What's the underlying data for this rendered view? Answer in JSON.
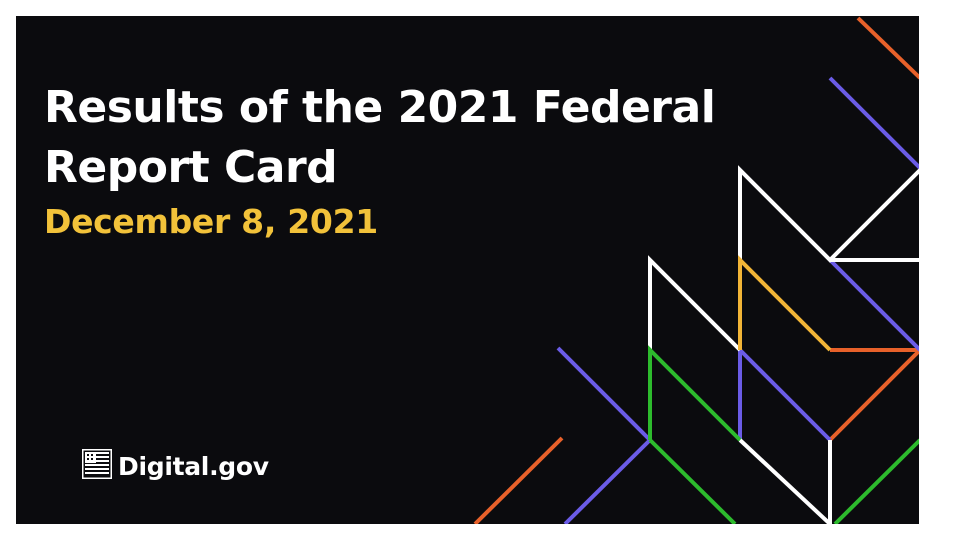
{
  "slide": {
    "title": "Results of the 2021 Federal Report Card",
    "date": "December 8, 2021",
    "logo_text": "Digital.gov"
  },
  "colors": {
    "background": "#0b0b0e",
    "title": "#ffffff",
    "date": "#f2c23a",
    "line_white": "#ffffff",
    "line_purple": "#6b5ce7",
    "line_orange": "#e8612a",
    "line_yellow": "#f2b537",
    "line_green": "#2dbb2d"
  },
  "icons": [
    "flag-icon"
  ]
}
